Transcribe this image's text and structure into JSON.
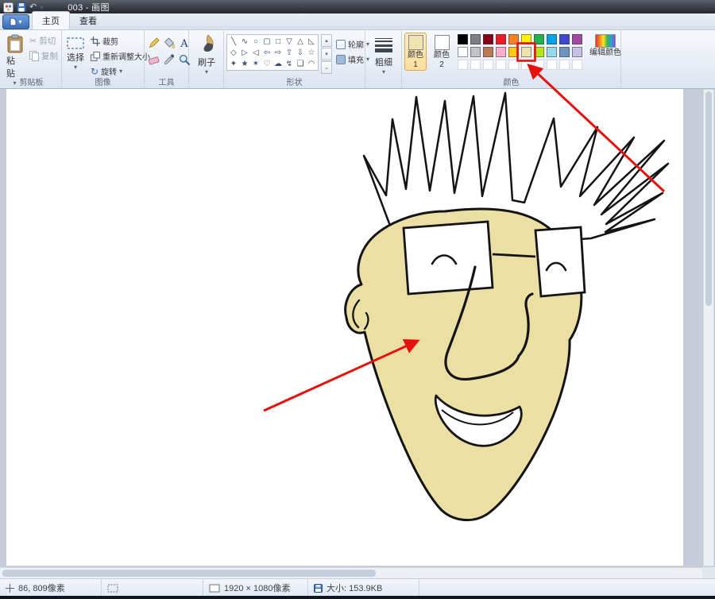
{
  "window": {
    "title": "003 - 画图"
  },
  "tabs": {
    "home": "主页",
    "view": "查看"
  },
  "icons": {
    "dropdown": "▾",
    "cut": "✂",
    "rotate": "↻",
    "undo": "↶",
    "scroll_up": "▴",
    "scroll_down": "▾",
    "gallery_more": "⌄",
    "text_tool": "A"
  },
  "ribbon": {
    "clipboard": {
      "label": "剪贴板",
      "paste": "粘贴",
      "cut": "剪切",
      "copy": "复制"
    },
    "image": {
      "label": "图像",
      "select": "选择",
      "crop": "裁剪",
      "resize": "重新调整大小",
      "rotate": "旋转"
    },
    "tools": {
      "label": "工具"
    },
    "brushes": {
      "label": "刷子"
    },
    "shapes": {
      "label": "形状",
      "outline": "轮廓",
      "fill": "填充",
      "glyphs": [
        "╲",
        "∿",
        "○",
        "▢",
        "□",
        "▽",
        "△",
        "◺",
        "◇",
        "▷",
        "◁",
        "⇦",
        "⇨",
        "⇧",
        "⇩",
        "☆",
        "✦",
        "★",
        "✶",
        "♡",
        "☁",
        "↯",
        "❏",
        "◠"
      ]
    },
    "size": {
      "label": "粗细"
    },
    "colors": {
      "label": "颜色",
      "color1_label": "颜色 1",
      "color1_value": "#EFE4B0",
      "color2_label": "颜色 2",
      "color2_value": "#FFFFFF",
      "edit_label": "编辑颜色",
      "palette_row1": [
        "#000000",
        "#7F7F7F",
        "#880015",
        "#ED1C24",
        "#FF7F27",
        "#FFF200",
        "#22B14C",
        "#00A2E8",
        "#3F48CC",
        "#A349A4"
      ],
      "palette_row2": [
        "#FFFFFF",
        "#C3C3C3",
        "#B97A57",
        "#FFAEC9",
        "#FFC90E",
        "#EFE4B0",
        "#B5E61D",
        "#99D9EA",
        "#7092BE",
        "#C8BFE7"
      ],
      "palette_row3": [
        "",
        "",
        "",
        "",
        "",
        "",
        "",
        "",
        "",
        ""
      ],
      "highlight": {
        "row": 1,
        "col": 5
      }
    }
  },
  "statusbar": {
    "cursor_position": "86, 809像素",
    "canvas_size": "1920 × 1080像素",
    "file_size": "大小: 153.9KB"
  },
  "annotations": {
    "color": "#e8100c"
  },
  "drawing": {
    "face_fill": "#EBDFA4",
    "outline": "#141414"
  }
}
